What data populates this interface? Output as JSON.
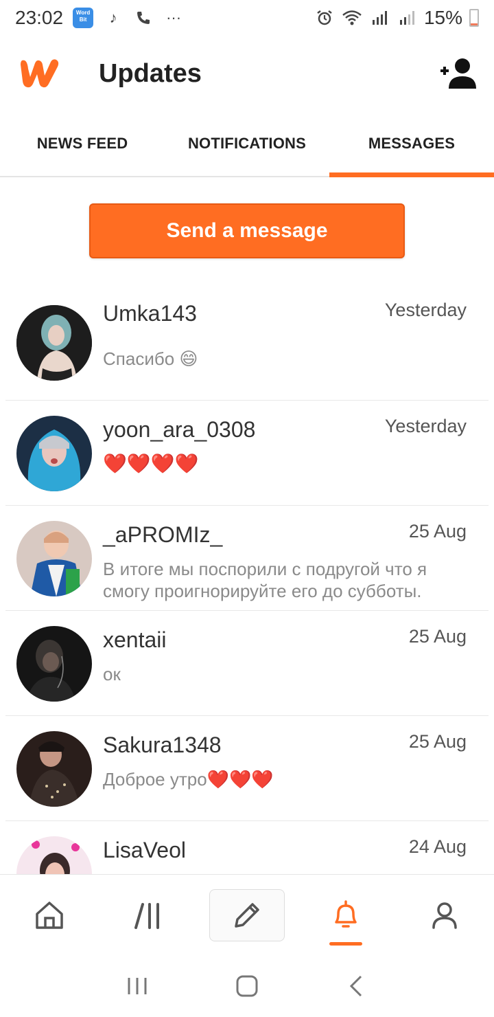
{
  "status_bar": {
    "time": "23:02",
    "battery": "15%",
    "more": "···",
    "wordbit_label": "Word Bit"
  },
  "header": {
    "title": "Updates"
  },
  "tabs": [
    {
      "label": "NEWS FEED",
      "active": false
    },
    {
      "label": "NOTIFICATIONS",
      "active": false
    },
    {
      "label": "MESSAGES",
      "active": true
    }
  ],
  "send_message_label": "Send a message",
  "messages": [
    {
      "name": "Umka143",
      "time": "Yesterday",
      "text": "Спасибо 😄"
    },
    {
      "name": "yoon_ara_0308",
      "time": "Yesterday",
      "text": "❤️❤️❤️❤️"
    },
    {
      "name": "_aPROMIz_",
      "time": "25 Aug",
      "text": "В итоге мы поспорили с подругой что я смогу проигнорируйте его до субботы."
    },
    {
      "name": "xentaii",
      "time": "25 Aug",
      "text": "ок"
    },
    {
      "name": "Sakura1348",
      "time": "25 Aug",
      "text": "Доброе утро❤️❤️❤️"
    },
    {
      "name": "LisaVeol",
      "time": "24 Aug",
      "text": ""
    }
  ],
  "bottom_nav": [
    {
      "icon": "home-icon",
      "active": false
    },
    {
      "icon": "library-icon",
      "active": false
    },
    {
      "icon": "write-icon",
      "active": false
    },
    {
      "icon": "bell-icon",
      "active": true
    },
    {
      "icon": "profile-icon",
      "active": false
    }
  ],
  "colors": {
    "accent": "#ff6d22",
    "text": "#222222",
    "muted": "#8a8a8a"
  }
}
